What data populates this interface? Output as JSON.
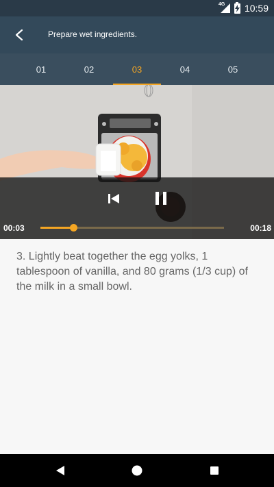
{
  "status_bar": {
    "network": "4G",
    "time": "10:59"
  },
  "app_bar": {
    "title": "Prepare wet ingredients."
  },
  "tabs": [
    {
      "label": "01",
      "active": false
    },
    {
      "label": "02",
      "active": false
    },
    {
      "label": "03",
      "active": true
    },
    {
      "label": "04",
      "active": false
    },
    {
      "label": "05",
      "active": false
    }
  ],
  "video": {
    "current_time": "00:03",
    "duration": "00:18",
    "progress": 0.18,
    "accent_color": "#f5a623"
  },
  "instruction": {
    "text": "3. Lightly beat together the egg yolks, 1 tablespoon of vanilla, and 80 grams (1/3 cup) of the milk in a small bowl."
  },
  "icons": {
    "back": "arrow-left-icon",
    "prev": "skip-previous-icon",
    "pause": "pause-icon",
    "nav_back": "triangle-back-icon",
    "nav_home": "circle-home-icon",
    "nav_recents": "square-recents-icon"
  }
}
